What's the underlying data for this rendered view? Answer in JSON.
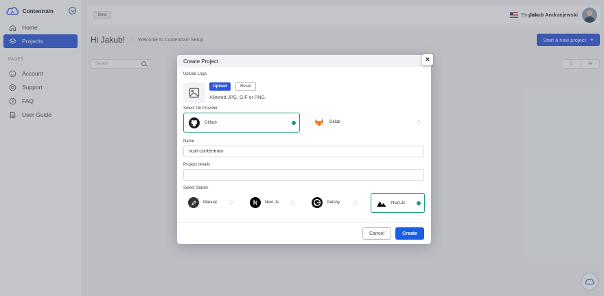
{
  "app": {
    "brand": "Contentrain",
    "beta_label": "Beta",
    "language": "English",
    "user_name": "Jakub Andrzejewski"
  },
  "sidebar": {
    "items": [
      {
        "label": "Home",
        "icon": "home-icon"
      },
      {
        "label": "Projects",
        "icon": "layers-icon",
        "active": true
      }
    ],
    "section_label": "PAGES",
    "pages": [
      {
        "label": "Account",
        "icon": "smile-icon"
      },
      {
        "label": "Support",
        "icon": "lifebuoy-icon"
      },
      {
        "label": "FAQ",
        "icon": "help-circle-icon"
      },
      {
        "label": "User Guide",
        "icon": "document-icon"
      }
    ]
  },
  "main": {
    "greeting": "Hi Jakub!",
    "welcome": "Welcome to Contentrain Setup",
    "start_button": "Start a new project",
    "start_button_icon": "+",
    "search_placeholder": "Search",
    "view_filter": "▽",
    "view_grid": "☷"
  },
  "modal": {
    "title": "Create Project",
    "close": "×",
    "upload_logo_label": "Upload Logo",
    "upload_button": "Upload",
    "reset_button": "Reset",
    "allowed_text": "Allowed JPG, GIF or PNG.",
    "git_provider_label": "Select Git Provider",
    "providers": [
      {
        "name": "Github",
        "selected": true
      },
      {
        "name": "Gitlab",
        "selected": false
      }
    ],
    "name_label": "Name",
    "name_value": "nuxt-contentrain",
    "details_label": "Projejct details",
    "details_value": "",
    "starter_label": "Select Starter",
    "starters": [
      {
        "name": "Manual",
        "selected": false
      },
      {
        "name": "Next.Js",
        "selected": false
      },
      {
        "name": "Gatsby",
        "selected": false
      },
      {
        "name": "Nuxt.Js",
        "selected": true
      }
    ],
    "cancel_button": "Cancel",
    "create_button": "Create"
  },
  "colors": {
    "primary": "#2b57d9",
    "create": "#1a5ee8",
    "selected_border": "#1c9a79",
    "gitlab": "#e24329"
  }
}
